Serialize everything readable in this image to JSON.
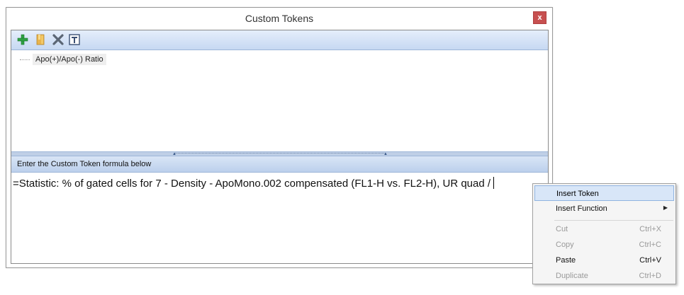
{
  "window": {
    "title": "Custom Tokens",
    "close_label": "x"
  },
  "toolbar": {
    "buttons": [
      {
        "icon": "add-icon",
        "tooltip": ""
      },
      {
        "icon": "folder-icon",
        "tooltip": ""
      },
      {
        "icon": "delete-icon",
        "tooltip": ""
      },
      {
        "icon": "text-token-icon",
        "tooltip": ""
      }
    ]
  },
  "tokens": {
    "items": [
      {
        "label": "Apo(+)/Apo(-) Ratio"
      }
    ]
  },
  "formula": {
    "header": "Enter the Custom Token formula below",
    "value": "=Statistic: % of gated cells for 7 -  Density - ApoMono.002 compensated (FL1-H vs. FL2-H), UR quad /"
  },
  "context_menu": {
    "items": [
      {
        "label": "Insert Token",
        "shortcut": "",
        "state": "highlighted",
        "submenu": false
      },
      {
        "label": "Insert Function",
        "shortcut": "",
        "state": "enabled",
        "submenu": true
      },
      {
        "label": "Cut",
        "shortcut": "Ctrl+X",
        "state": "disabled",
        "submenu": false
      },
      {
        "label": "Copy",
        "shortcut": "Ctrl+C",
        "state": "disabled",
        "submenu": false
      },
      {
        "label": "Paste",
        "shortcut": "Ctrl+V",
        "state": "enabled",
        "submenu": false
      },
      {
        "label": "Duplicate",
        "shortcut": "Ctrl+D",
        "state": "disabled",
        "submenu": false
      }
    ]
  },
  "colors": {
    "accent": "#c6d8f2",
    "close_button": "#c75050",
    "menu_highlight": "#d8e6f8"
  }
}
